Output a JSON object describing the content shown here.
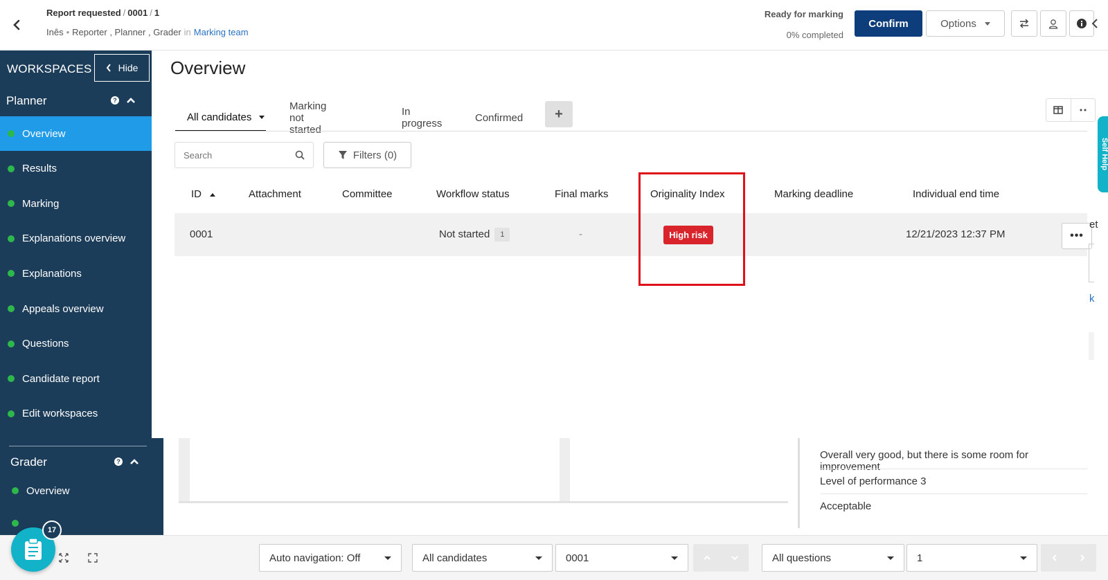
{
  "header": {
    "breadcrumb": [
      "Report requested",
      "0001",
      "1"
    ],
    "breadcrumb_sep": "/",
    "user": "Inês",
    "roles": "Reporter , Planner , Grader",
    "in_label": "in",
    "team": "Marking team",
    "status_title": "Ready for marking",
    "status_progress": "0% completed",
    "confirm_label": "Confirm",
    "options_label": "Options"
  },
  "sidebar": {
    "title": "WORKSPACES",
    "hide_label": "Hide",
    "planner": {
      "label": "Planner",
      "items": [
        {
          "label": "Overview",
          "active": true
        },
        {
          "label": "Results"
        },
        {
          "label": "Marking"
        },
        {
          "label": "Explanations overview"
        },
        {
          "label": "Explanations"
        },
        {
          "label": "Appeals overview"
        },
        {
          "label": "Questions"
        },
        {
          "label": "Candidate report"
        },
        {
          "label": "Edit workspaces"
        }
      ]
    },
    "grader": {
      "label": "Grader",
      "items": [
        {
          "label": "Overview"
        }
      ]
    }
  },
  "main": {
    "title": "Overview",
    "tabs": [
      {
        "label": "All candidates",
        "active": true
      },
      {
        "label": "Marking not started"
      },
      {
        "label": "In progress"
      },
      {
        "label": "Confirmed"
      }
    ],
    "add_tab_label": "+",
    "search_placeholder": "Search",
    "filters_label": "Filters (0)",
    "columns": [
      "ID",
      "Attachment",
      "Committee",
      "Workflow status",
      "Final marks",
      "Originality Index",
      "Marking deadline",
      "Individual end time"
    ],
    "rows": [
      {
        "id": "0001",
        "attachment": "",
        "committee": "",
        "workflow_status": "Not started",
        "workflow_count": "1",
        "final_marks": "-",
        "originality": "High risk",
        "marking_deadline": "",
        "end_time": "12/21/2023 12:37 PM",
        "menu_label": "•••"
      }
    ]
  },
  "background_panel": {
    "partial_text_1": "et",
    "partial_text_2": "k",
    "feedback": "Overall very good, but there is some room for improvement",
    "level_label": "Level of performance 3",
    "level_value": "Acceptable"
  },
  "self_help_label": "Self Help",
  "bottom_bar": {
    "auto_nav": "Auto navigation: Off",
    "candidates": "All candidates",
    "candidate_id": "0001",
    "questions": "All questions",
    "question_no": "1"
  },
  "fab": {
    "badge": "17"
  },
  "colors": {
    "sidebar": "#1c3d5a",
    "active_nav": "#1f9be8",
    "confirm": "#0d3d7a",
    "high_risk": "#d9242b",
    "status_dot": "#2eb84c",
    "accent_teal": "#12b3c9",
    "highlight": "#e0101a"
  }
}
